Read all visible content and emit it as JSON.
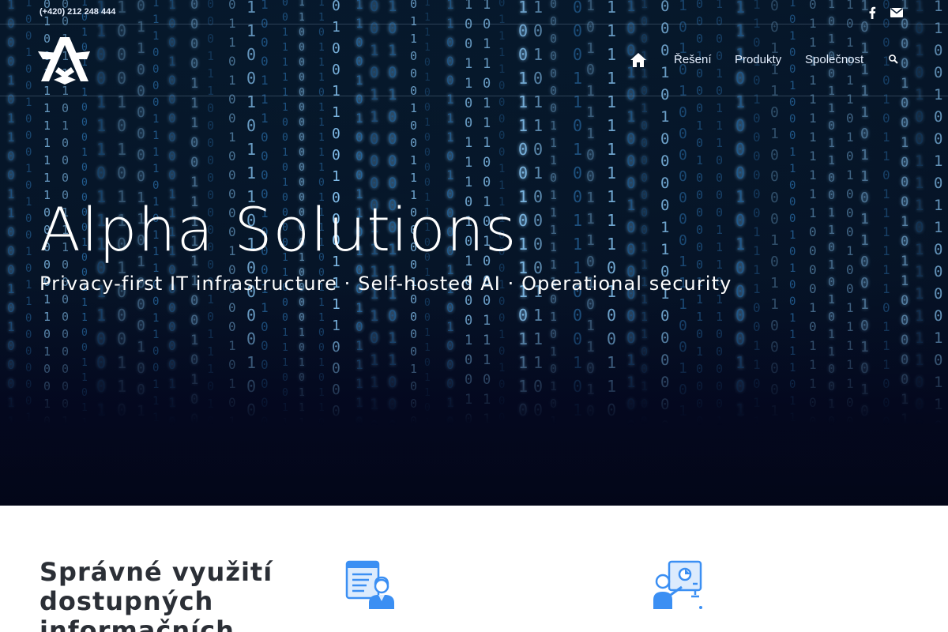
{
  "topbar": {
    "phone": "(+420) 212 248 444",
    "social": [
      {
        "icon": "facebook-icon"
      },
      {
        "icon": "mail-icon"
      }
    ]
  },
  "header": {
    "logo": "alpha-logo",
    "nav": {
      "home_icon": "home-icon",
      "items": [
        {
          "label": "Řešení"
        },
        {
          "label": "Produkty"
        },
        {
          "label": "Společnost"
        }
      ],
      "search_icon": "search-icon"
    }
  },
  "hero": {
    "title": "Alpha Solutions",
    "subtitle": "Privacy-first IT infrastructure · Self-hosted AI · Operational security"
  },
  "content": {
    "title": "Správné využití dostupných informačních",
    "features": [
      {
        "icon": "document-support-icon"
      },
      {
        "icon": "presentation-analytics-icon"
      }
    ]
  },
  "colors": {
    "hero_bg": "#061528",
    "rain_bright": "#8fd0ff",
    "rain_dim": "#2a6ea8",
    "accent_blue": "#3b8ff3",
    "text_dark": "#2b2f36"
  }
}
